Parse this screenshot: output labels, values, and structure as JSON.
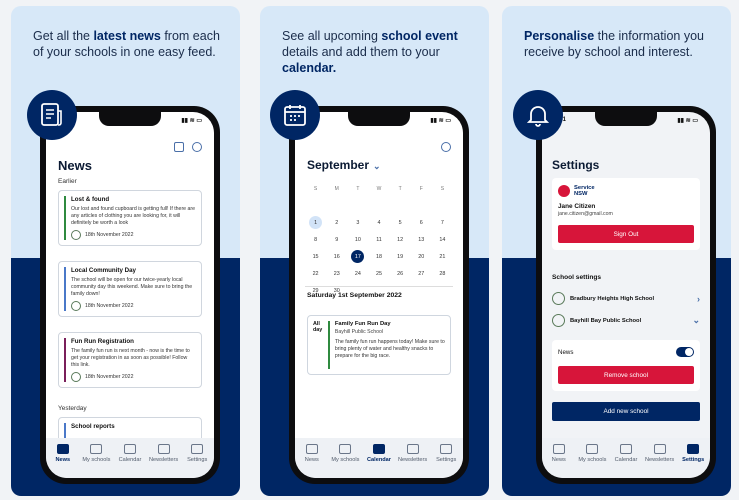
{
  "colors": {
    "navy": "#002664",
    "light_blue": "#d7e8f8",
    "red": "#d7153a"
  },
  "status_bar": {
    "time": "9:41"
  },
  "panel1": {
    "headline": {
      "pre": "Get all the ",
      "bold": "latest news",
      "post": " from each of your schools in one easy feed."
    },
    "badge_icon": "newspaper-icon",
    "title": "News",
    "earlier": "Earlier",
    "yesterday": "Yesterday",
    "cards": [
      {
        "title": "Lost & found",
        "body": "Our lost and found cupboard is getting full! If there are any articles of clothing you are looking for, it will definitely be worth a look",
        "date": "18th November 2022",
        "bar": "#2f8a3f"
      },
      {
        "title": "Local Community Day",
        "body": "The school will be open for our twice-yearly local community day this weekend. Make sure to bring the family down!",
        "date": "18th November 2022",
        "bar": "#4a78c8"
      },
      {
        "title": "Fun Run Registration",
        "body": "The family fun run is next month - now is the time to get your registration in as soon as possible! Follow this link.",
        "date": "18th November 2022",
        "bar": "#7a1f5a"
      },
      {
        "title": "School reports",
        "body": "",
        "date": "",
        "bar": "#4a78c8"
      }
    ]
  },
  "panel2": {
    "headline": {
      "pre": "See all upcoming ",
      "bold": "school event",
      "post": " details and add them to your ",
      "bold2": "calendar."
    },
    "badge_icon": "calendar-icon",
    "month": "September",
    "day_headers": [
      "S",
      "M",
      "T",
      "W",
      "T",
      "F",
      "S"
    ],
    "days": [
      "",
      "",
      "",
      "",
      "",
      "",
      "",
      "1",
      "2",
      "3",
      "4",
      "5",
      "6",
      "7",
      "8",
      "9",
      "10",
      "11",
      "12",
      "13",
      "14",
      "15",
      "16",
      "17",
      "18",
      "19",
      "20",
      "21",
      "22",
      "23",
      "24",
      "25",
      "26",
      "27",
      "28",
      "29",
      "30"
    ],
    "selected_day": "1",
    "today_day": "17",
    "event_date": "Saturday 1st September 2022",
    "event": {
      "allday": "All day",
      "title": "Family Fun Run Day",
      "school": "Bayhill Public School",
      "body": "The family fun run happens today! Make sure to bring plenty of water and healthy snacks to prepare for the big race."
    }
  },
  "panel3": {
    "headline": {
      "bold": "Personalise",
      "post": " the information you receive by school and interest."
    },
    "badge_icon": "bell-icon",
    "title": "Settings",
    "service_nsw": [
      "Service",
      "NSW"
    ],
    "user": {
      "name": "Jane Citizen",
      "email": "jane.citizen@gmail.com"
    },
    "sign_out": "Sign Out",
    "school_settings": "School settings",
    "schools": [
      "Bradbury Heights High School",
      "Bayhill Bay Public School"
    ],
    "news_label": "News",
    "remove_school": "Remove school",
    "add_school": "Add new school"
  },
  "tabs": [
    {
      "label": "News",
      "icon": "news-icon"
    },
    {
      "label": "My schools",
      "icon": "school-icon"
    },
    {
      "label": "Calendar",
      "icon": "calendar-icon"
    },
    {
      "label": "Newsletters",
      "icon": "newsletter-icon"
    },
    {
      "label": "Settings",
      "icon": "gear-icon"
    }
  ]
}
